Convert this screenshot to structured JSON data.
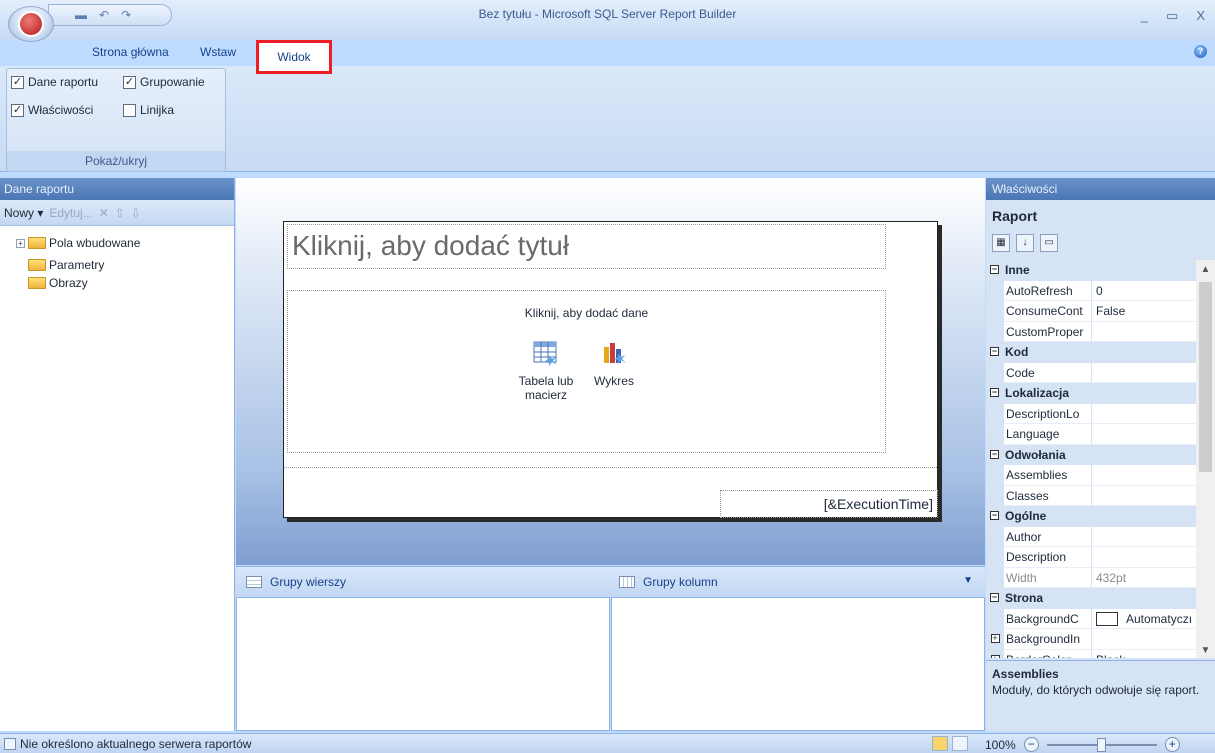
{
  "window": {
    "title": "Bez tytułu - Microsoft SQL Server Report Builder",
    "minimize": "_",
    "maximize": "▭",
    "close": "X"
  },
  "ribbon": {
    "tabs": [
      "Strona główna",
      "Wstaw",
      "Widok"
    ],
    "active_tab": "Widok",
    "group_label": "Pokaż/ukryj",
    "checkboxes": [
      {
        "label": "Dane raportu",
        "checked": true
      },
      {
        "label": "Grupowanie",
        "checked": true
      },
      {
        "label": "Właściwości",
        "checked": true
      },
      {
        "label": "Linijka",
        "checked": false
      }
    ]
  },
  "left_panel": {
    "header": "Dane raportu",
    "toolbar": {
      "new": "Nowy ▾",
      "edit": "Edytuj..."
    },
    "tree": [
      "Pola wbudowane",
      "Parametry",
      "Obrazy"
    ]
  },
  "report": {
    "title_placeholder": "Kliknij, aby dodać tytuł",
    "add_data": "Kliknij, aby dodać dane",
    "tool_table": "Tabela lub macierz",
    "tool_chart": "Wykres",
    "footer_expression": "[&ExecutionTime]"
  },
  "grouping": {
    "row_groups": "Grupy wierszy",
    "column_groups": "Grupy kolumn"
  },
  "properties": {
    "header": "Właściwości",
    "object": "Raport",
    "rows": [
      {
        "kind": "cat",
        "name": "Inne"
      },
      {
        "kind": "prop",
        "name": "AutoRefresh",
        "value": "0"
      },
      {
        "kind": "prop",
        "name": "ConsumeCont",
        "value": "False"
      },
      {
        "kind": "prop",
        "name": "CustomProper",
        "value": ""
      },
      {
        "kind": "cat",
        "name": "Kod"
      },
      {
        "kind": "prop",
        "name": "Code",
        "value": ""
      },
      {
        "kind": "cat",
        "name": "Lokalizacja"
      },
      {
        "kind": "prop",
        "name": "DescriptionLo",
        "value": ""
      },
      {
        "kind": "prop",
        "name": "Language",
        "value": ""
      },
      {
        "kind": "cat",
        "name": "Odwołania"
      },
      {
        "kind": "prop",
        "name": "Assemblies",
        "value": ""
      },
      {
        "kind": "prop",
        "name": "Classes",
        "value": ""
      },
      {
        "kind": "cat",
        "name": "Ogólne"
      },
      {
        "kind": "prop",
        "name": "Author",
        "value": ""
      },
      {
        "kind": "prop",
        "name": "Description",
        "value": ""
      },
      {
        "kind": "prop",
        "name": "Width",
        "value": "432pt",
        "dim": true
      },
      {
        "kind": "cat",
        "name": "Strona"
      },
      {
        "kind": "prop",
        "name": "BackgroundC",
        "value": "Automatyczı",
        "swatch": true
      },
      {
        "kind": "prop",
        "name": "BackgroundIn",
        "value": "",
        "expand": true
      },
      {
        "kind": "prop",
        "name": "BorderColor",
        "value": "Black",
        "expand": true
      }
    ],
    "desc_title": "Assemblies",
    "desc_text": "Moduły, do których odwołuje się raport."
  },
  "status": {
    "text": "Nie określono aktualnego serwera raportów",
    "zoom": "100%"
  },
  "colors": {
    "highlight": "#ee1c24",
    "panel_header": "#4a76b5"
  }
}
